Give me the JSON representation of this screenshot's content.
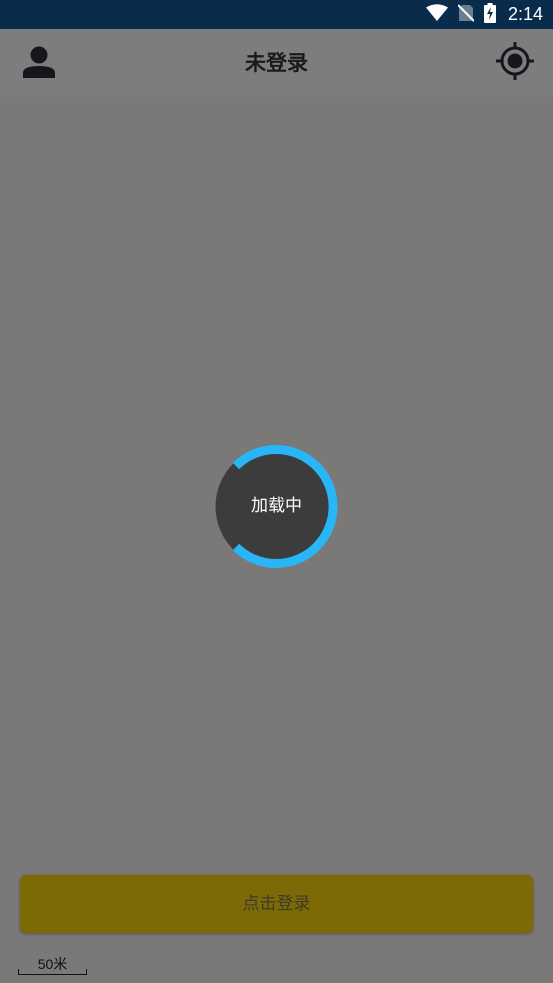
{
  "status_bar": {
    "time": "2:14",
    "icons": [
      "wifi-icon",
      "no-sim-icon",
      "battery-charging-icon"
    ]
  },
  "app_bar": {
    "title": "未登录",
    "left_icon": "person-icon",
    "right_icon": "my-location-icon"
  },
  "loading": {
    "text": "加载中",
    "spinner_color": "#29b6f6"
  },
  "login_button": {
    "label": "点击登录"
  },
  "map": {
    "scale_label": "50米"
  },
  "colors": {
    "status_bar": "#0a2c4c",
    "overlay": "#7a7978",
    "login_button": "#7d6a06",
    "spinner": "#29b6f6",
    "loader_disc": "#3c3c3c"
  }
}
